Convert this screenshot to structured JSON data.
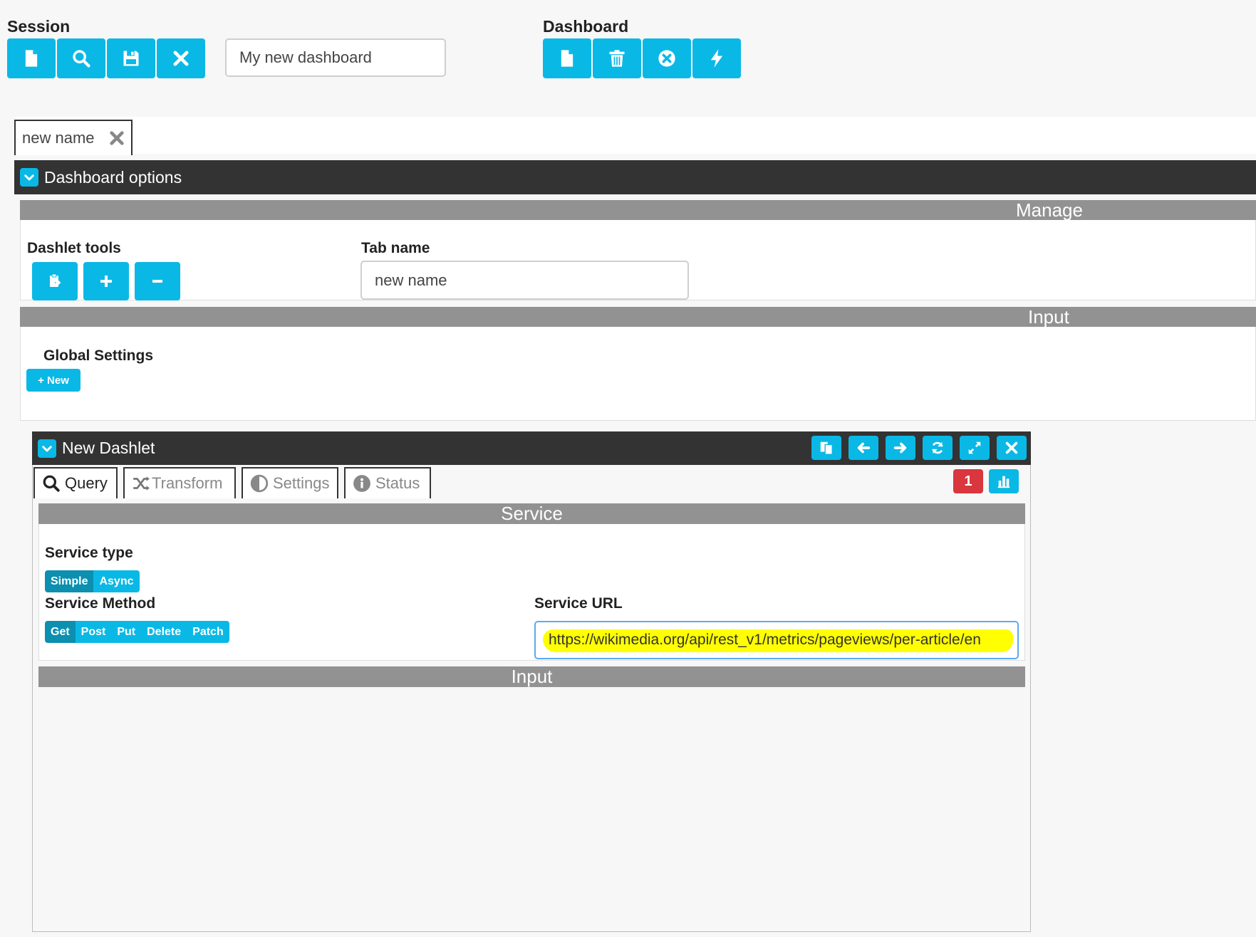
{
  "session": {
    "label": "Session",
    "buttons": [
      "new-file-icon",
      "search-icon",
      "save-icon",
      "close-icon"
    ],
    "name_value": "My new dashboard"
  },
  "dashboard": {
    "label": "Dashboard",
    "buttons": [
      "new-file-icon",
      "trash-icon",
      "remove-circle-icon",
      "lightning-icon"
    ]
  },
  "tabs": [
    {
      "label": "new name"
    }
  ],
  "dashboard_options": {
    "title": "Dashboard options",
    "manage": {
      "header": "Manage",
      "dashlet_tools_label": "Dashlet tools",
      "tab_name_label": "Tab name",
      "tab_name_value": "new name"
    },
    "input": {
      "header": "Input",
      "global_settings_label": "Global Settings",
      "new_button": "+ New"
    }
  },
  "dashlet": {
    "title": "New Dashlet",
    "header_buttons": [
      "copy-icon",
      "arrow-left-icon",
      "arrow-right-icon",
      "refresh-icon",
      "expand-icon",
      "close-icon"
    ],
    "tabs": [
      {
        "label": "Query",
        "icon": "search-icon",
        "active": true
      },
      {
        "label": "Transform",
        "icon": "shuffle-icon",
        "active": false
      },
      {
        "label": "Settings",
        "icon": "half-circle-icon",
        "active": false
      },
      {
        "label": "Status",
        "icon": "info-icon",
        "active": false
      }
    ],
    "badge_count": "1",
    "service": {
      "header": "Service",
      "type_label": "Service type",
      "type_options": [
        "Simple",
        "Async"
      ],
      "type_selected": "Simple",
      "method_label": "Service Method",
      "method_options": [
        "Get",
        "Post",
        "Put",
        "Delete",
        "Patch"
      ],
      "method_selected": "Get",
      "url_label": "Service URL",
      "url_value": "https://wikimedia.org/api/rest_v1/metrics/pageviews/per-article/en"
    },
    "input_header": "Input"
  },
  "colors": {
    "accent": "#0ab8e6",
    "accent_dark": "#0d8fb0",
    "dark_bar": "#333333",
    "gray_bar": "#929292",
    "badge": "#d9363e",
    "highlight": "#ffff00"
  }
}
